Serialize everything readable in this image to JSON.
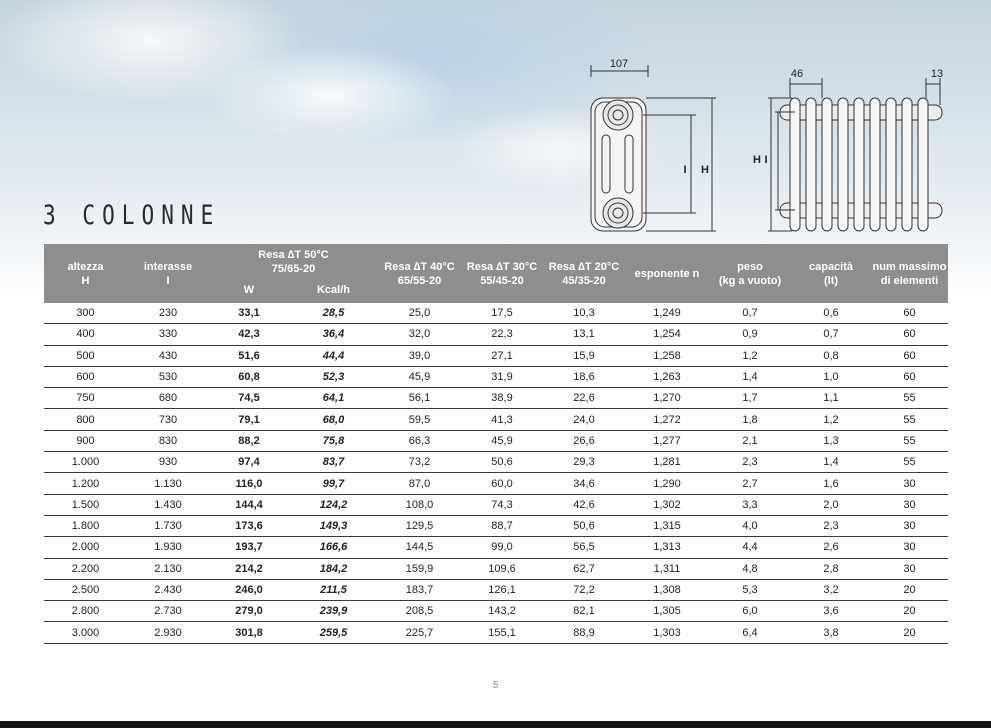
{
  "title": "3 COLONNE",
  "drawing_labels": {
    "depth": "107",
    "pitch": "46",
    "hub": "13",
    "i": "I",
    "h": "H"
  },
  "table": {
    "headers": {
      "altezza": [
        "altezza",
        "H"
      ],
      "interasse": [
        "interasse",
        "I"
      ],
      "resa50": [
        "Resa ∆T 50°C",
        "75/65-20"
      ],
      "w": "W",
      "kcal": "Kcal/h",
      "resa40": [
        "Resa ∆T 40°C",
        "65/55-20"
      ],
      "resa30": [
        "Resa ∆T 30°C",
        "55/45-20"
      ],
      "resa20": [
        "Resa ∆T 20°C",
        "45/35-20"
      ],
      "esponente": "esponente n",
      "peso": [
        "peso",
        "(kg a vuoto)"
      ],
      "capacita": [
        "capacità",
        "(lt)"
      ],
      "elementi": [
        "num massimo",
        "di elementi"
      ]
    },
    "rows": [
      [
        "300",
        "230",
        "33,1",
        "28,5",
        "25,0",
        "17,5",
        "10,3",
        "1,249",
        "0,7",
        "0,6",
        "60"
      ],
      [
        "400",
        "330",
        "42,3",
        "36,4",
        "32,0",
        "22,3",
        "13,1",
        "1,254",
        "0,9",
        "0,7",
        "60"
      ],
      [
        "500",
        "430",
        "51,6",
        "44,4",
        "39,0",
        "27,1",
        "15,9",
        "1,258",
        "1,2",
        "0,8",
        "60"
      ],
      [
        "600",
        "530",
        "60,8",
        "52,3",
        "45,9",
        "31,9",
        "18,6",
        "1,263",
        "1,4",
        "1,0",
        "60"
      ],
      [
        "750",
        "680",
        "74,5",
        "64,1",
        "56,1",
        "38,9",
        "22,6",
        "1,270",
        "1,7",
        "1,1",
        "55"
      ],
      [
        "800",
        "730",
        "79,1",
        "68,0",
        "59,5",
        "41,3",
        "24,0",
        "1,272",
        "1,8",
        "1,2",
        "55"
      ],
      [
        "900",
        "830",
        "88,2",
        "75,8",
        "66,3",
        "45,9",
        "26,6",
        "1,277",
        "2,1",
        "1,3",
        "55"
      ],
      [
        "1.000",
        "930",
        "97,4",
        "83,7",
        "73,2",
        "50,6",
        "29,3",
        "1,281",
        "2,3",
        "1,4",
        "55"
      ],
      [
        "1.200",
        "1.130",
        "116,0",
        "99,7",
        "87,0",
        "60,0",
        "34,6",
        "1,290",
        "2,7",
        "1,6",
        "30"
      ],
      [
        "1.500",
        "1.430",
        "144,4",
        "124,2",
        "108,0",
        "74,3",
        "42,6",
        "1,302",
        "3,3",
        "2,0",
        "30"
      ],
      [
        "1.800",
        "1.730",
        "173,6",
        "149,3",
        "129,5",
        "88,7",
        "50,6",
        "1,315",
        "4,0",
        "2,3",
        "30"
      ],
      [
        "2.000",
        "1.930",
        "193,7",
        "166,6",
        "144,5",
        "99,0",
        "56,5",
        "1,313",
        "4,4",
        "2,6",
        "30"
      ],
      [
        "2.200",
        "2.130",
        "214,2",
        "184,2",
        "159,9",
        "109,6",
        "62,7",
        "1,311",
        "4,8",
        "2,8",
        "30"
      ],
      [
        "2.500",
        "2.430",
        "246,0",
        "211,5",
        "183,7",
        "126,1",
        "72,2",
        "1,308",
        "5,3",
        "3,2",
        "20"
      ],
      [
        "2.800",
        "2.730",
        "279,0",
        "239,9",
        "208,5",
        "143,2",
        "82,1",
        "1,305",
        "6,0",
        "3,6",
        "20"
      ],
      [
        "3.000",
        "2.930",
        "301,8",
        "259,5",
        "225,7",
        "155,1",
        "88,9",
        "1,303",
        "6,4",
        "3,8",
        "20"
      ]
    ]
  },
  "page_number": "5"
}
